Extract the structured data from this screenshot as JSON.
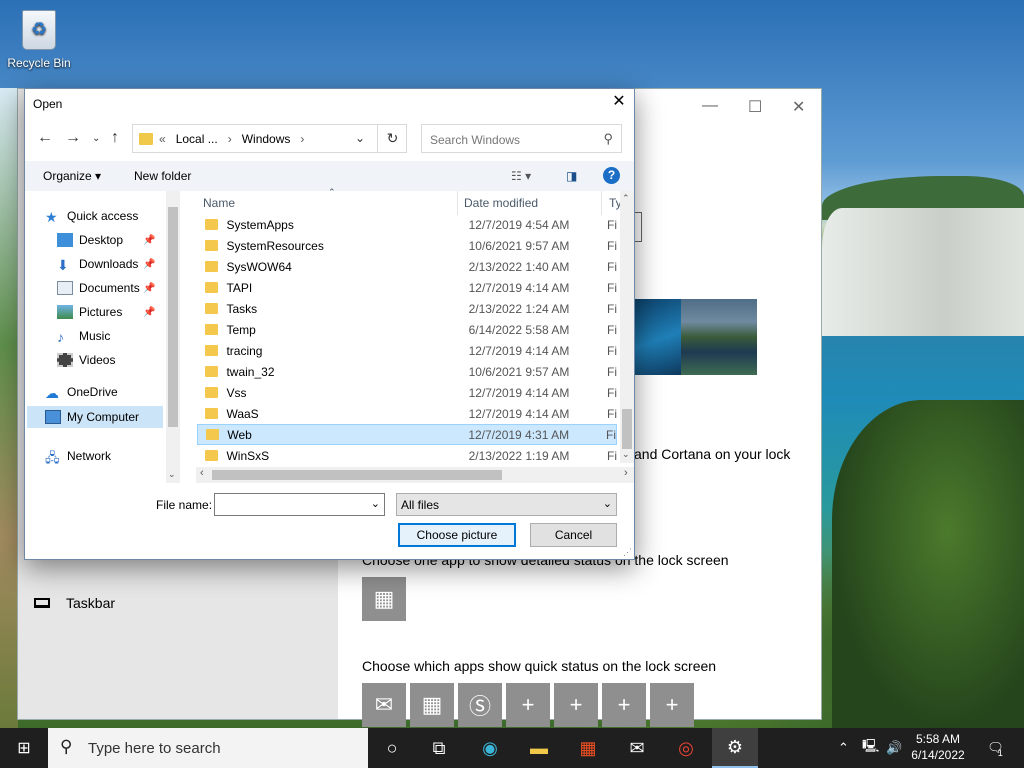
{
  "desktop": {
    "recycle_bin_label": "Recycle Bin"
  },
  "settings_window": {
    "taskbar_item": "Taskbar",
    "cortana_text": "and Cortana on your lock",
    "detailed_status_text": "Choose one app to show detailed status on the lock screen",
    "quick_status_text": "Choose which apps show quick status on the lock screen",
    "window_controls": [
      "—",
      "☐",
      "✕"
    ]
  },
  "dialog": {
    "title": "Open",
    "address": {
      "prefix": "«",
      "crumbs": [
        "Local ...",
        "Windows"
      ]
    },
    "search_placeholder": "Search Windows",
    "toolbar": {
      "organize": "Organize ▾",
      "new_folder": "New folder"
    },
    "nav_items": [
      {
        "label": "Quick access",
        "icon": "star-icon"
      },
      {
        "label": "Desktop",
        "icon": "desktop-icon",
        "pinned": true
      },
      {
        "label": "Downloads",
        "icon": "download-icon",
        "pinned": true
      },
      {
        "label": "Documents",
        "icon": "documents-icon",
        "pinned": true
      },
      {
        "label": "Pictures",
        "icon": "pictures-icon",
        "pinned": true
      },
      {
        "label": "Music",
        "icon": "music-icon"
      },
      {
        "label": "Videos",
        "icon": "videos-icon"
      },
      {
        "label": "OneDrive",
        "icon": "cloud-icon"
      },
      {
        "label": "My Computer",
        "icon": "computer-icon",
        "selected": true
      },
      {
        "label": "Network",
        "icon": "network-icon"
      }
    ],
    "columns": {
      "name": "Name",
      "date": "Date modified",
      "type": "Ty"
    },
    "files": [
      {
        "name": "SystemApps",
        "date": "12/7/2019 4:54 AM",
        "type": "Fi"
      },
      {
        "name": "SystemResources",
        "date": "10/6/2021 9:57 AM",
        "type": "Fi"
      },
      {
        "name": "SysWOW64",
        "date": "2/13/2022 1:40 AM",
        "type": "Fi"
      },
      {
        "name": "TAPI",
        "date": "12/7/2019 4:14 AM",
        "type": "Fi"
      },
      {
        "name": "Tasks",
        "date": "2/13/2022 1:24 AM",
        "type": "Fi"
      },
      {
        "name": "Temp",
        "date": "6/14/2022 5:58 AM",
        "type": "Fi"
      },
      {
        "name": "tracing",
        "date": "12/7/2019 4:14 AM",
        "type": "Fi"
      },
      {
        "name": "twain_32",
        "date": "10/6/2021 9:57 AM",
        "type": "Fi"
      },
      {
        "name": "Vss",
        "date": "12/7/2019 4:14 AM",
        "type": "Fi"
      },
      {
        "name": "WaaS",
        "date": "12/7/2019 4:14 AM",
        "type": "Fi"
      },
      {
        "name": "Web",
        "date": "12/7/2019 4:31 AM",
        "type": "Fi",
        "selected": true
      },
      {
        "name": "WinSxS",
        "date": "2/13/2022 1:19 AM",
        "type": "Fi"
      }
    ],
    "file_name_label": "File name:",
    "file_name_value": "",
    "file_type_value": "All files",
    "choose_button": "Choose picture",
    "cancel_button": "Cancel"
  },
  "taskbar": {
    "search_placeholder": "Type here to search",
    "time": "5:58 AM",
    "date": "6/14/2022",
    "notification_count": "1"
  },
  "colors": {
    "accent": "#0078d7",
    "selection": "#cce8ff",
    "taskbar": "#1f1f1f"
  }
}
